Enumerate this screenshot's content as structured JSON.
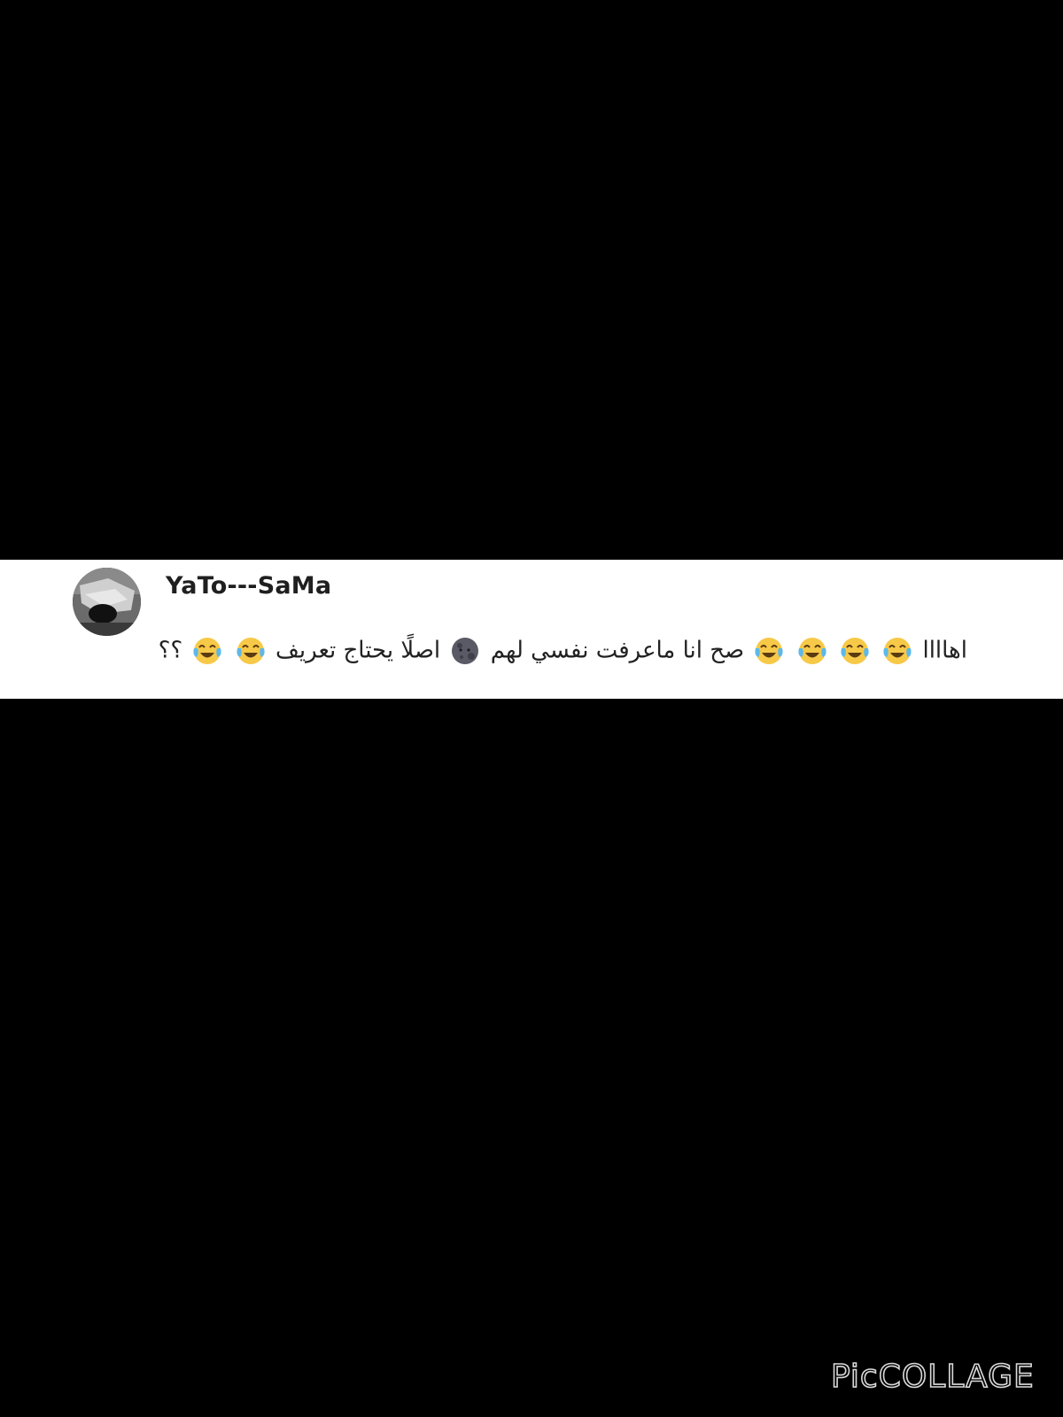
{
  "comment": {
    "username": "YaTo---SaMa",
    "segments": [
      {
        "type": "text",
        "value": "اهاااا"
      },
      {
        "type": "emoji",
        "icon": "face-with-tears-of-joy-icon"
      },
      {
        "type": "emoji",
        "icon": "face-with-tears-of-joy-icon"
      },
      {
        "type": "emoji",
        "icon": "face-with-tears-of-joy-icon"
      },
      {
        "type": "emoji",
        "icon": "face-with-tears-of-joy-icon"
      },
      {
        "type": "text",
        "value": "صح انا ماعرفت نفسي لهم"
      },
      {
        "type": "emoji",
        "icon": "new-moon-face-icon"
      },
      {
        "type": "text",
        "value": "اصلًا يحتاج تعريف"
      },
      {
        "type": "emoji",
        "icon": "face-with-tears-of-joy-icon"
      },
      {
        "type": "emoji",
        "icon": "face-with-tears-of-joy-icon"
      },
      {
        "type": "text",
        "value": "؟؟"
      }
    ]
  },
  "watermark": {
    "text": "PicCOLLAGE"
  },
  "colors": {
    "background": "#000000",
    "strip": "#ffffff",
    "username": "#1f1f1f",
    "emoji_face": "#f7c948",
    "emoji_tears": "#5db8ea",
    "moon": "#5a5a66"
  }
}
